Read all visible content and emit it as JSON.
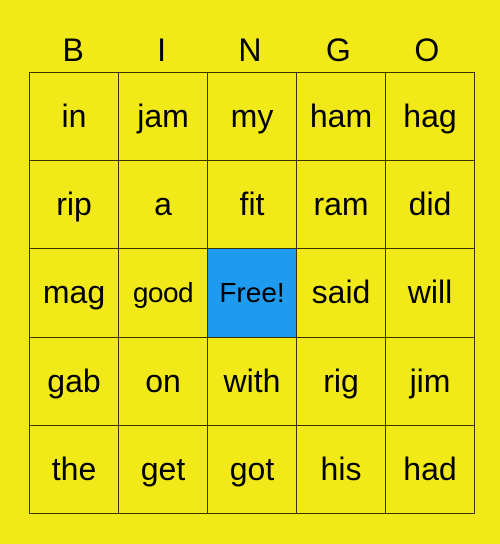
{
  "header": [
    "B",
    "I",
    "N",
    "G",
    "O"
  ],
  "colors": {
    "background": "#f2e918",
    "free_cell": "#1e9bef"
  },
  "rows": [
    [
      "in",
      "jam",
      "my",
      "ham",
      "hag"
    ],
    [
      "rip",
      "a",
      "fit",
      "ram",
      "did"
    ],
    [
      "mag",
      "good",
      "Free!",
      "said",
      "will"
    ],
    [
      "gab",
      "on",
      "with",
      "rig",
      "jim"
    ],
    [
      "the",
      "get",
      "got",
      "his",
      "had"
    ]
  ],
  "free_cell": {
    "row": 2,
    "col": 2
  }
}
